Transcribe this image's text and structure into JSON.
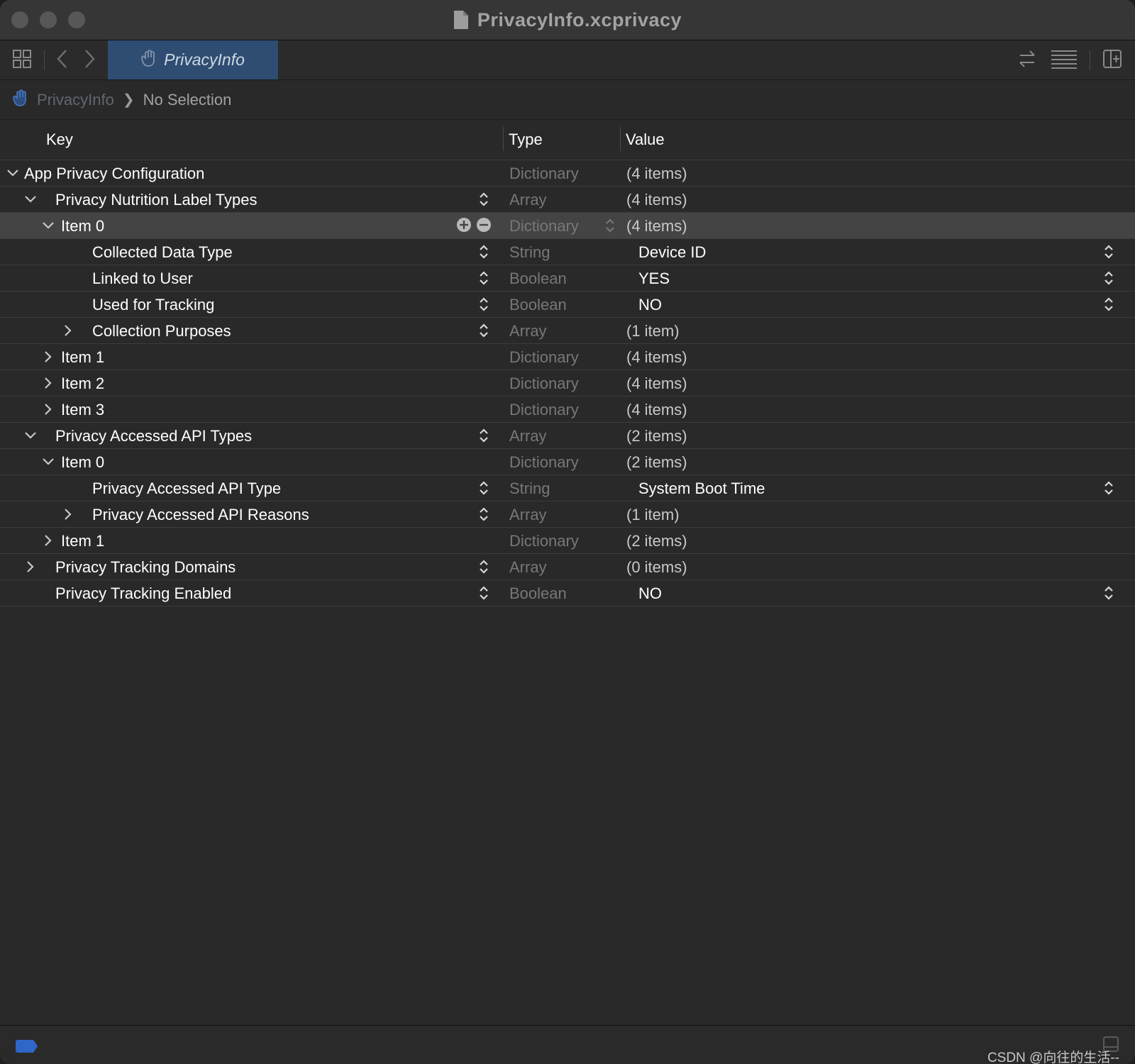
{
  "window": {
    "title": "PrivacyInfo.xcprivacy"
  },
  "toolbar": {
    "tab_label": "PrivacyInfo"
  },
  "breadcrumb": {
    "file": "PrivacyInfo",
    "separator": "❯",
    "selection": "No Selection"
  },
  "columns": {
    "key": "Key",
    "type": "Type",
    "value": "Value"
  },
  "rows": [
    {
      "key": "App Privacy Configuration",
      "type": "Dictionary",
      "value": "(4 items)"
    },
    {
      "key": "Privacy Nutrition Label Types",
      "type": "Array",
      "value": "(4 items)"
    },
    {
      "key": "Item 0",
      "type": "Dictionary",
      "value": "(4 items)"
    },
    {
      "key": "Collected Data Type",
      "type": "String",
      "value": "Device ID"
    },
    {
      "key": "Linked to User",
      "type": "Boolean",
      "value": "YES"
    },
    {
      "key": "Used for Tracking",
      "type": "Boolean",
      "value": "NO"
    },
    {
      "key": "Collection Purposes",
      "type": "Array",
      "value": "(1 item)"
    },
    {
      "key": "Item 1",
      "type": "Dictionary",
      "value": "(4 items)"
    },
    {
      "key": "Item 2",
      "type": "Dictionary",
      "value": "(4 items)"
    },
    {
      "key": "Item 3",
      "type": "Dictionary",
      "value": "(4 items)"
    },
    {
      "key": "Privacy Accessed API Types",
      "type": "Array",
      "value": "(2 items)"
    },
    {
      "key": "Item 0",
      "type": "Dictionary",
      "value": "(2 items)"
    },
    {
      "key": "Privacy Accessed API Type",
      "type": "String",
      "value": "System Boot Time"
    },
    {
      "key": "Privacy Accessed API Reasons",
      "type": "Array",
      "value": "(1 item)"
    },
    {
      "key": "Item 1",
      "type": "Dictionary",
      "value": "(2 items)"
    },
    {
      "key": "Privacy Tracking Domains",
      "type": "Array",
      "value": "(0 items)"
    },
    {
      "key": "Privacy Tracking Enabled",
      "type": "Boolean",
      "value": "NO"
    }
  ],
  "watermark": "CSDN @向往的生活--",
  "colors": {
    "tab_active": "#2f4d72",
    "selected_row": "#444444",
    "accent": "#2f66c8"
  }
}
